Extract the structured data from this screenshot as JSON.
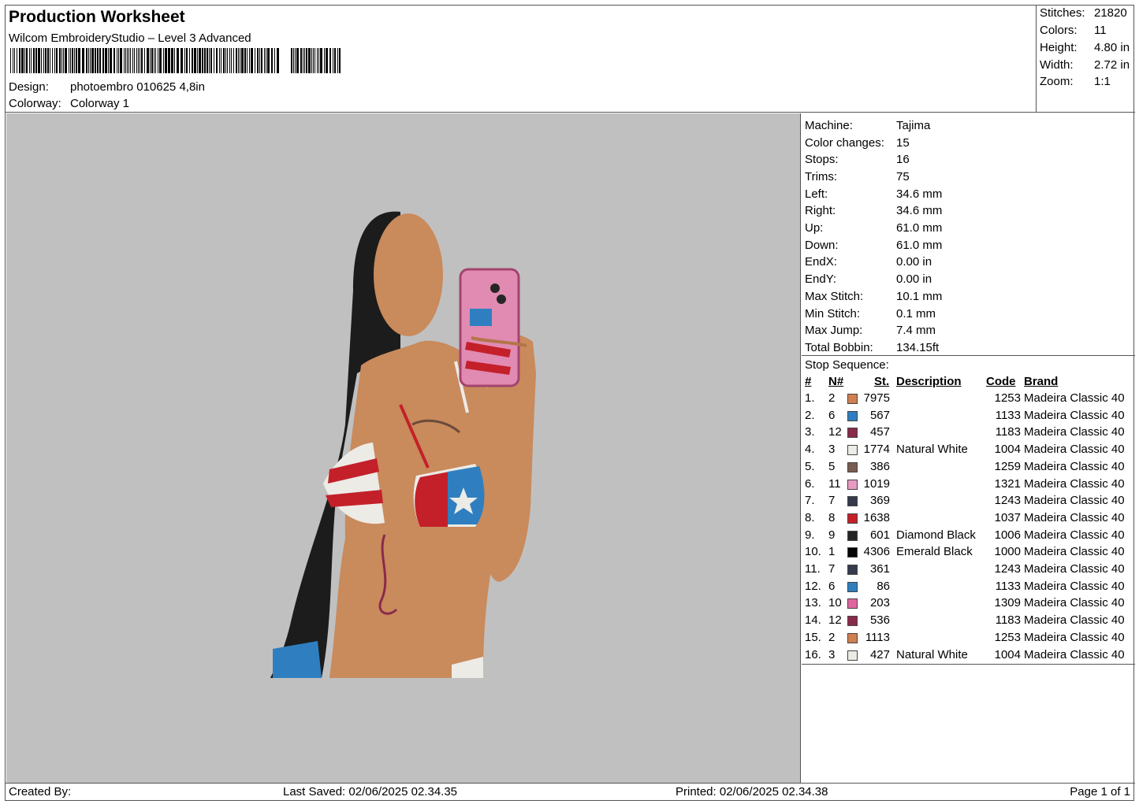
{
  "header": {
    "title": "Production Worksheet",
    "subtitle": "Wilcom EmbroideryStudio – Level 3 Advanced",
    "design_label": "Design:",
    "design_value": "photoembro 010625 4,8in",
    "colorway_label": "Colorway:",
    "colorway_value": "Colorway 1"
  },
  "summary": [
    {
      "label": "Stitches:",
      "value": "21820"
    },
    {
      "label": "Colors:",
      "value": "11"
    },
    {
      "label": "Height:",
      "value": "4.80 in"
    },
    {
      "label": "Width:",
      "value": "2.72 in"
    },
    {
      "label": "Zoom:",
      "value": "1:1"
    }
  ],
  "machine_info": [
    {
      "label": "Machine:",
      "value": "Tajima"
    },
    {
      "label": "Color changes:",
      "value": "15"
    },
    {
      "label": "Stops:",
      "value": "16"
    },
    {
      "label": "Trims:",
      "value": "75"
    },
    {
      "label": "Left:",
      "value": "34.6 mm"
    },
    {
      "label": "Right:",
      "value": "34.6 mm"
    },
    {
      "label": "Up:",
      "value": "61.0 mm"
    },
    {
      "label": "Down:",
      "value": "61.0 mm"
    },
    {
      "label": "EndX:",
      "value": "0.00 in"
    },
    {
      "label": "EndY:",
      "value": "0.00 in"
    },
    {
      "label": "Max Stitch:",
      "value": "10.1 mm"
    },
    {
      "label": "Min Stitch:",
      "value": "0.1 mm"
    },
    {
      "label": "Max Jump:",
      "value": "7.4 mm"
    },
    {
      "label": "Total Bobbin:",
      "value": "134.15ft"
    }
  ],
  "stop_sequence": {
    "title": "Stop Sequence:",
    "headers": {
      "num": "#",
      "n": "N#",
      "st": "St.",
      "desc": "Description",
      "code": "Code",
      "brand": "Brand"
    },
    "rows": [
      {
        "num": "1.",
        "n": "2",
        "color": "#d08050",
        "st": "7975",
        "desc": "",
        "code": "1253",
        "brand": "Madeira Classic 40"
      },
      {
        "num": "2.",
        "n": "6",
        "color": "#2f7fc0",
        "st": "567",
        "desc": "",
        "code": "1133",
        "brand": "Madeira Classic 40"
      },
      {
        "num": "3.",
        "n": "12",
        "color": "#8a2a4a",
        "st": "457",
        "desc": "",
        "code": "1183",
        "brand": "Madeira Classic 40"
      },
      {
        "num": "4.",
        "n": "3",
        "color": "#ecebe6",
        "st": "1774",
        "desc": "Natural White",
        "code": "1004",
        "brand": "Madeira Classic 40"
      },
      {
        "num": "5.",
        "n": "5",
        "color": "#7a5d52",
        "st": "386",
        "desc": "",
        "code": "1259",
        "brand": "Madeira Classic 40"
      },
      {
        "num": "6.",
        "n": "11",
        "color": "#e79ac2",
        "st": "1019",
        "desc": "",
        "code": "1321",
        "brand": "Madeira Classic 40"
      },
      {
        "num": "7.",
        "n": "7",
        "color": "#353a4c",
        "st": "369",
        "desc": "",
        "code": "1243",
        "brand": "Madeira Classic 40"
      },
      {
        "num": "8.",
        "n": "8",
        "color": "#c4202a",
        "st": "1638",
        "desc": "",
        "code": "1037",
        "brand": "Madeira Classic 40"
      },
      {
        "num": "9.",
        "n": "9",
        "color": "#262626",
        "st": "601",
        "desc": "Diamond Black",
        "code": "1006",
        "brand": "Madeira Classic 40"
      },
      {
        "num": "10.",
        "n": "1",
        "color": "#050505",
        "st": "4306",
        "desc": "Emerald Black",
        "code": "1000",
        "brand": "Madeira Classic 40"
      },
      {
        "num": "11.",
        "n": "7",
        "color": "#353a4c",
        "st": "361",
        "desc": "",
        "code": "1243",
        "brand": "Madeira Classic 40"
      },
      {
        "num": "12.",
        "n": "6",
        "color": "#2f7fc0",
        "st": "86",
        "desc": "",
        "code": "1133",
        "brand": "Madeira Classic 40"
      },
      {
        "num": "13.",
        "n": "10",
        "color": "#e0659e",
        "st": "203",
        "desc": "",
        "code": "1309",
        "brand": "Madeira Classic 40"
      },
      {
        "num": "14.",
        "n": "12",
        "color": "#8a2a4a",
        "st": "536",
        "desc": "",
        "code": "1183",
        "brand": "Madeira Classic 40"
      },
      {
        "num": "15.",
        "n": "2",
        "color": "#d08050",
        "st": "1113",
        "desc": "",
        "code": "1253",
        "brand": "Madeira Classic 40"
      },
      {
        "num": "16.",
        "n": "3",
        "color": "#ecebe6",
        "st": "427",
        "desc": "Natural White",
        "code": "1004",
        "brand": "Madeira Classic 40"
      }
    ]
  },
  "footer": {
    "created_by": "Created By:",
    "last_saved": "Last Saved: 02/06/2025 02.34.35",
    "printed": "Printed: 02/06/2025 02.34.38",
    "page": "Page 1 of 1"
  },
  "colors": {
    "canvas_bg": "#c0c0c0",
    "skin": "#c98a5c",
    "hair": "#1a1a1a",
    "phone": "#e18ab2",
    "bikini_red": "#c4202a",
    "bikini_white": "#ecebe6",
    "bikini_blue": "#2f7fc0"
  }
}
